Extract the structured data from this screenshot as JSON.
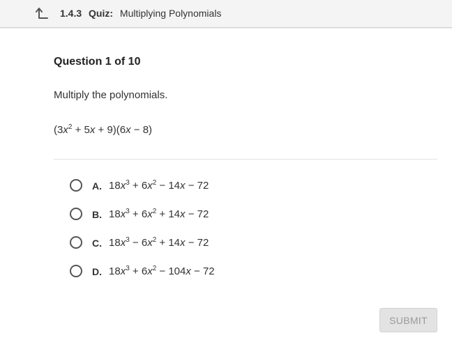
{
  "header": {
    "lesson_number": "1.4.3",
    "kind": "Quiz:",
    "title": "Multiplying Polynomials",
    "back_icon": "back-arrow-icon"
  },
  "question": {
    "heading": "Question 1 of 10",
    "prompt": "Multiply the polynomials.",
    "expression": {
      "a": "(3",
      "var1": "x",
      "exp1": "2",
      "b": " + 5",
      "var2": "x",
      "c": " + 9)(6",
      "var3": "x",
      "d": " − 8)"
    }
  },
  "options": [
    {
      "letter": "A.",
      "coef3": "18",
      "var3": "x",
      "exp3": "3",
      "mid": " + 6",
      "var2": "x",
      "exp2": "2",
      "rest": " − 14",
      "var1": "x",
      "end": " − 72"
    },
    {
      "letter": "B.",
      "coef3": "18",
      "var3": "x",
      "exp3": "3",
      "mid": " + 6",
      "var2": "x",
      "exp2": "2",
      "rest": " + 14",
      "var1": "x",
      "end": " − 72"
    },
    {
      "letter": "C.",
      "coef3": "18",
      "var3": "x",
      "exp3": "3",
      "mid": " − 6",
      "var2": "x",
      "exp2": "2",
      "rest": " + 14",
      "var1": "x",
      "end": " − 72"
    },
    {
      "letter": "D.",
      "coef3": "18",
      "var3": "x",
      "exp3": "3",
      "mid": " + 6",
      "var2": "x",
      "exp2": "2",
      "rest": " − 104",
      "var1": "x",
      "end": " − 72"
    }
  ],
  "submit_label": "SUBMIT",
  "colors": {
    "text": "#333333",
    "topbar": "#f4f4f4",
    "submit_bg": "#e3e3e3",
    "submit_text": "#9a9a9a"
  }
}
